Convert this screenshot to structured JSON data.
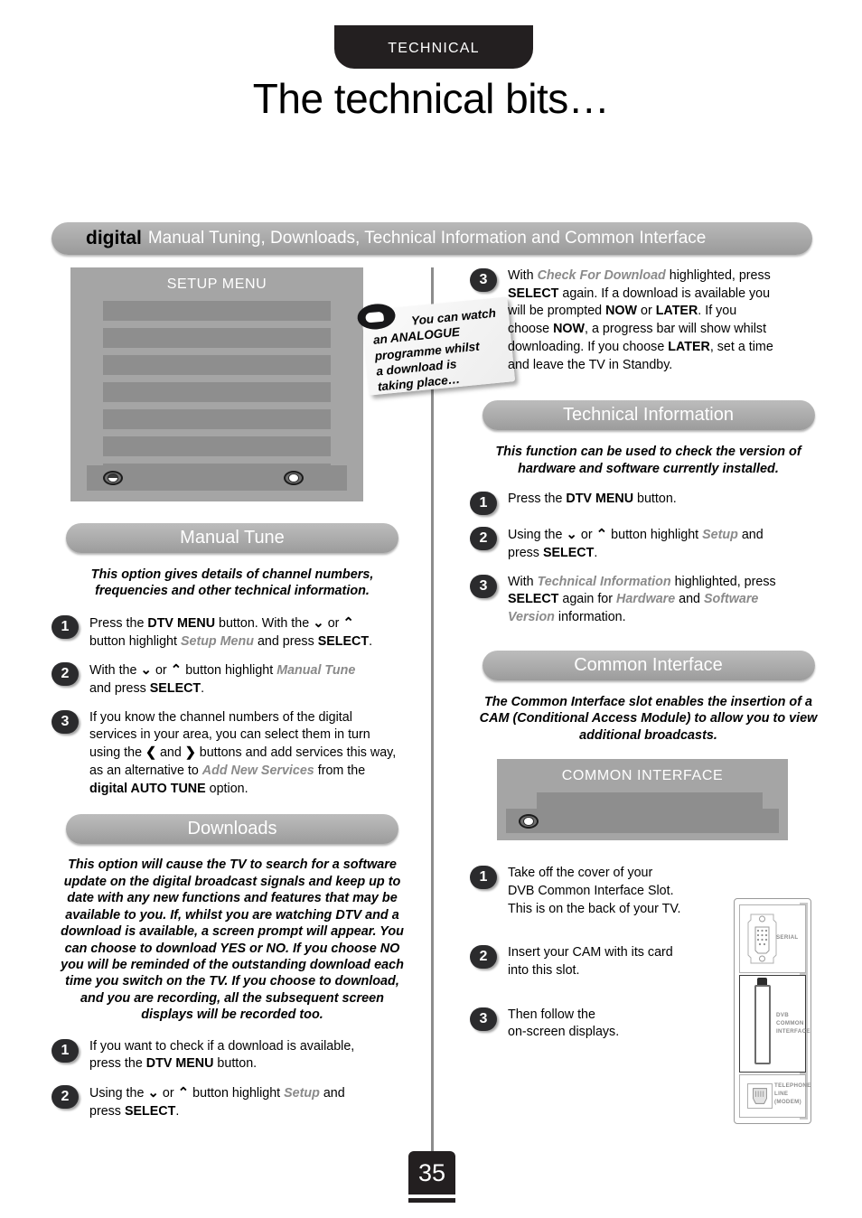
{
  "header": {
    "tab_label": "TECHNICAL",
    "title": "The technical bits…"
  },
  "banner": {
    "brand": "digital",
    "text": "Manual Tuning, Downloads, Technical Information and Common Interface"
  },
  "setup_menu_screen": {
    "title": "SETUP MENU",
    "row_count": 7,
    "left_icon": "disc-half-icon",
    "right_icon": "disc-icon"
  },
  "sticky_note": {
    "icon": "speech-bubble-icon",
    "line1": "You can watch",
    "line2": "an ANALOGUE",
    "line3": "programme whilst",
    "line4": "a download is",
    "line5": "taking place…"
  },
  "sections": {
    "manual_tune": {
      "title": "Manual Tune",
      "intro": "This option gives details of channel numbers, frequencies and other technical information.",
      "steps": [
        {
          "num": "1",
          "text": "Press the DTV MENU button. With the ∨ or ∧ button highlight Setup Menu and press SELECT."
        },
        {
          "num": "2",
          "text": "With the ∨ or ∧ button highlight Manual Tune and press SELECT."
        },
        {
          "num": "3",
          "text": "If you know the channel numbers of the digital services in your area, you can select them in turn using the ‹ and › buttons and add services this way, as an alternative to Add New Services from the digital AUTO TUNE option."
        }
      ]
    },
    "downloads": {
      "title": "Downloads",
      "intro": "This option will cause the TV to search for a software update on the digital broadcast signals and keep up to date with any new functions and features that may be available to you. If, whilst you are watching DTV and a download is available, a screen prompt will appear. You can choose to download YES or NO. If you choose NO you will be reminded of the outstanding download each time you switch on the TV. If you choose to download, and you are recording, all the subsequent screen displays will be recorded too.",
      "steps": [
        {
          "num": "1",
          "text": "If you want to check if a download is available, press the DTV MENU button."
        },
        {
          "num": "2",
          "text": "Using the ∨ or ∧ button highlight Setup and press SELECT."
        },
        {
          "num": "3",
          "text": "With Check For Download highlighted, press SELECT again. If a download is available you will be prompted NOW or LATER. If you choose NOW, a progress bar will show whilst downloading. If you choose LATER, set a time and leave the TV in Standby."
        }
      ]
    },
    "technical_information": {
      "title": "Technical Information",
      "intro": "This function can be used to check the version of hardware and software currently installed.",
      "steps": [
        {
          "num": "1",
          "text": "Press the DTV MENU button."
        },
        {
          "num": "2",
          "text": "Using the ∨ or ∧ button highlight Setup and press SELECT."
        },
        {
          "num": "3",
          "text": "With Technical Information highlighted, press SELECT again for Hardware and Software Version information."
        }
      ]
    },
    "common_interface": {
      "title": "Common Interface",
      "intro": "The Common Interface slot enables the insertion of a CAM (Conditional Access Module) to allow you to view additional broadcasts.",
      "screen_title": "COMMON INTERFACE",
      "steps": [
        {
          "num": "1",
          "text": "Take off the cover of your DVB Common Interface Slot. This is on the back of your TV."
        },
        {
          "num": "2",
          "text": "Insert your CAM with its card into this slot."
        },
        {
          "num": "3",
          "text": "Then follow the on-screen displays."
        }
      ]
    }
  },
  "connector_panel": {
    "serial_label": "SERIAL",
    "ci_label_line1": "DVB",
    "ci_label_line2": "COMMON",
    "ci_label_line3": "INTERFACE",
    "tel_label_line1": "TELEPHONE",
    "tel_label_line2": "LINE",
    "tel_label_line3": "(MODEM)"
  },
  "page_number": "35"
}
